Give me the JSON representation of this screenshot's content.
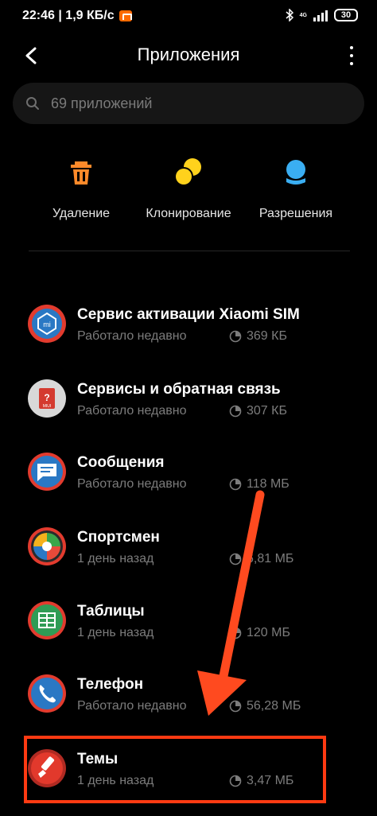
{
  "status_bar": {
    "time_speed": "22:46 | 1,9 КБ/с",
    "network": "4G",
    "battery": "30"
  },
  "header": {
    "title": "Приложения"
  },
  "search": {
    "placeholder": "69 приложений"
  },
  "actions": [
    {
      "label": "Удаление",
      "icon": "trash-icon",
      "color": "#ff8a2a"
    },
    {
      "label": "Клонирование",
      "icon": "clone-icon",
      "color": "#ffd21c"
    },
    {
      "label": "Разрешения",
      "icon": "permissions-icon",
      "color": "#3aaef2"
    }
  ],
  "apps": [
    {
      "name": "Сервис активации Xiaomi SIM",
      "status": "Работало недавно",
      "size": "369 КБ",
      "icon": "xiaomi-sim-icon"
    },
    {
      "name": "Сервисы и обратная связь",
      "status": "Работало недавно",
      "size": "307 КБ",
      "icon": "feedback-icon"
    },
    {
      "name": "Сообщения",
      "status": "Работало недавно",
      "size": "118 МБ",
      "icon": "messages-icon"
    },
    {
      "name": "Спортсмен",
      "status": "1 день назад",
      "size": "6,81 МБ",
      "icon": "sportsman-icon"
    },
    {
      "name": "Таблицы",
      "status": "1 день назад",
      "size": "120 МБ",
      "icon": "sheets-icon"
    },
    {
      "name": "Телефон",
      "status": "Работало недавно",
      "size": "56,28 МБ",
      "icon": "phone-icon"
    },
    {
      "name": "Темы",
      "status": "1 день назад",
      "size": "3,47 МБ",
      "icon": "themes-icon"
    }
  ],
  "colors": {
    "annotation": "#ff3a12",
    "muted_text": "#7c7c7c",
    "search_bg": "#161616"
  }
}
